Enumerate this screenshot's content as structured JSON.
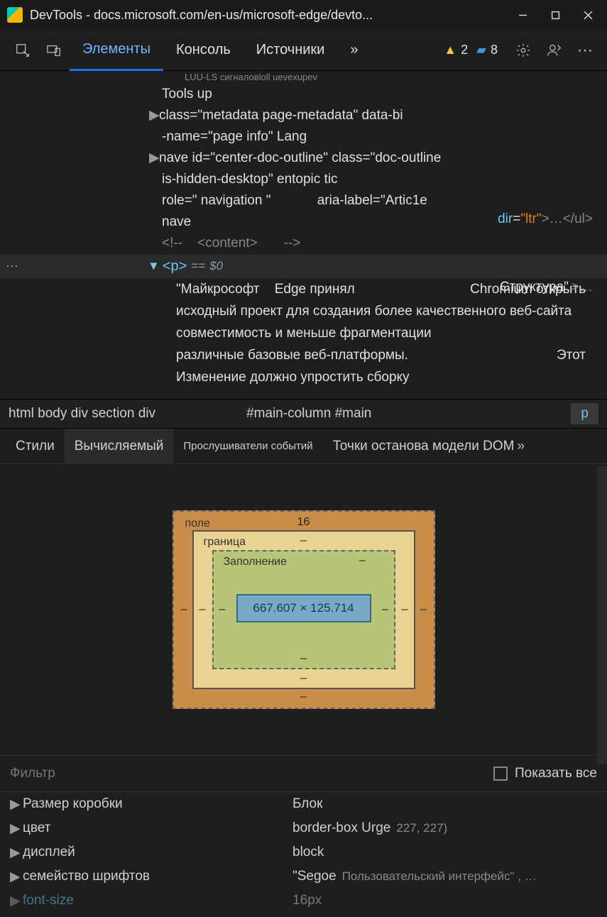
{
  "titlebar": {
    "title": "DevTools - docs.microsoft.com/en-us/microsoft-edge/devto..."
  },
  "toolbar": {
    "tabs": [
      "Элементы",
      "Консоль",
      "Источники"
    ],
    "warn_count": "2",
    "info_count": "8"
  },
  "dom": {
    "small": "LUU-LS сигналовloll uevexupev",
    "l0": "Tools up",
    "l1": "class=\"metadata page-metadata\" data-bi",
    "l2": "-name=\"page info\" Lang",
    "dir_attr": "dir",
    "dir_val": "\"ltr\"",
    "dir_tail": ">…</ul>",
    "l3": "nave id=\"center-doc-outline\" class=\"doc-outline",
    "l4": "is-hidden-desktop\" entopic tic",
    "l5a": "role=\" navigation \"",
    "l5b": "aria-label=\"Artic1e",
    "l5c": "Структура\"",
    "l5d": ">…",
    "l6": "nave",
    "l7a": "<!--",
    "l7b": "<content>",
    "l7c": "-->",
    "sel_tag": "<p>",
    "sel_eq": "==",
    "sel_var": "$0",
    "t1a": "\"Майкрософт",
    "t1b": "Edge принял",
    "t1c": "Chromium открыть",
    "t2": "исходный проект для создания более качественного веб-сайта",
    "t3": "совместимость и меньше фрагментации",
    "t4a": "различные базовые веб-платформы.",
    "t4b": "Этот",
    "t5": "Изменение должно упростить сборку"
  },
  "breadcrumb": {
    "path": "html body div section div",
    "mid": "#main-column #main",
    "tag": "p"
  },
  "subtabs": {
    "styles": "Стили",
    "computed": "Вычисляемый",
    "listeners": "Прослушиватели событий",
    "dom_bp": "Точки останова модели DOM"
  },
  "boxmodel": {
    "margin_label": "поле",
    "border_label": "граница",
    "padding_label": "Заполнение",
    "margin_top": "16",
    "dash": "–",
    "content": "667.607 × 125.714"
  },
  "filter": {
    "placeholder": "Фильтр",
    "show_all": "Показать все"
  },
  "props": [
    {
      "key": "Размер коробки",
      "val": "Блок",
      "render": ""
    },
    {
      "key": "цвет",
      "val": "border-box Urge",
      "render": "227, 227)"
    },
    {
      "key": "дисплей",
      "val": "block",
      "render": ""
    },
    {
      "key": "семейство шрифтов",
      "val": "\"Segoe",
      "render": "Пользовательский интерфейс\" , …"
    },
    {
      "key": "font-size",
      "val": "16px",
      "render": ""
    }
  ]
}
